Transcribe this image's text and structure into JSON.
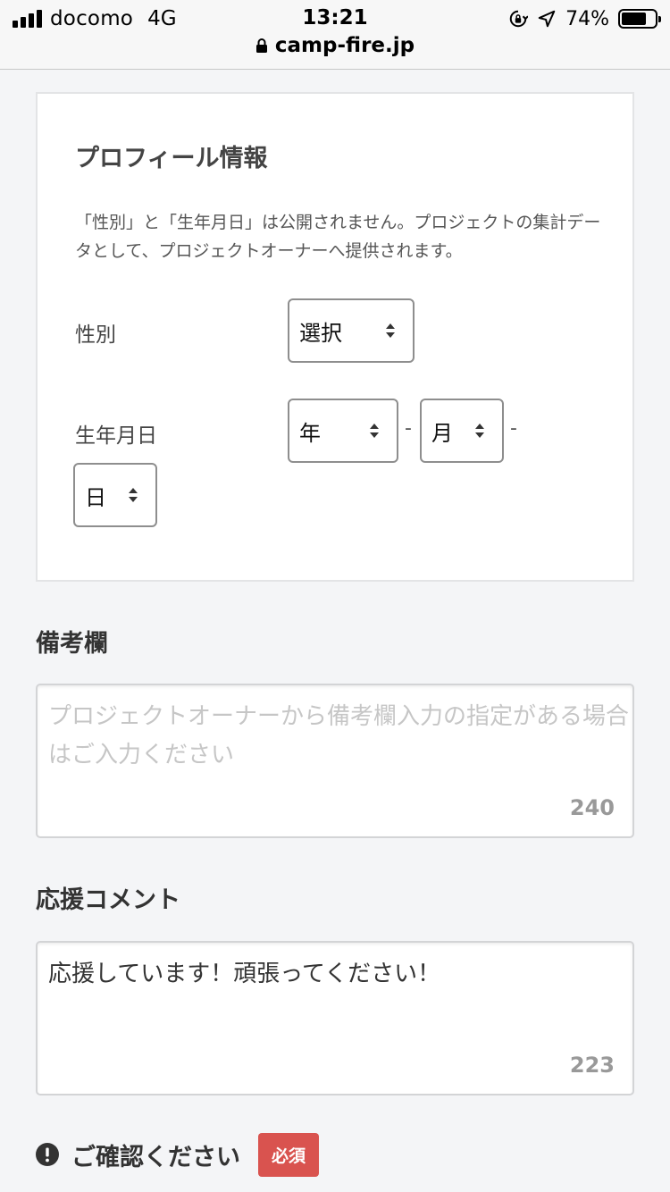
{
  "status_bar": {
    "carrier": "docomo",
    "network": "4G",
    "time": "13:21",
    "battery_percent": "74%",
    "battery_level": 0.74
  },
  "browser": {
    "url": "camp-fire.jp"
  },
  "profile": {
    "title": "プロフィール情報",
    "description": "「性別」と「生年月日」は公開されません。プロジェクトの集計データとして、プロジェクトオーナーへ提供されます。",
    "gender_label": "性別",
    "gender_select": "選択",
    "birthday_label": "生年月日",
    "year_select": "年",
    "month_select": "月",
    "day_select": "日",
    "separator": "-"
  },
  "remarks": {
    "title": "備考欄",
    "placeholder": "プロジェクトオーナーから備考欄入力の指定がある場合はご入力ください",
    "remaining": "240"
  },
  "support_comment": {
    "title": "応援コメント",
    "value": "応援しています！頑張ってください！",
    "remaining": "223"
  },
  "confirm": {
    "label": "ご確認ください",
    "badge": "必須"
  }
}
